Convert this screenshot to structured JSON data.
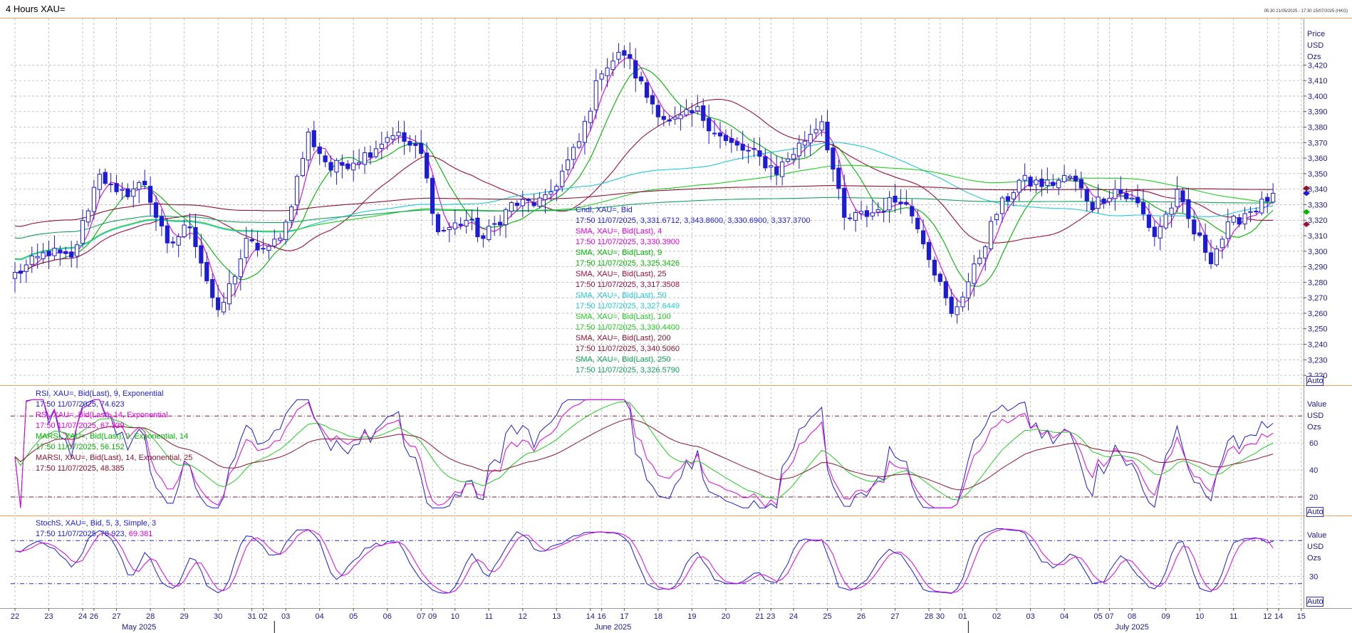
{
  "header": {
    "title": "4 Hours XAU=",
    "date_range": "05:30 21/05/2025 - 17:30 15/07/2025 (HKG)"
  },
  "colors": {
    "candle": "#1c1cd6",
    "sma4": "#e000e0",
    "sma9": "#00b400",
    "sma25": "#9c0f3c",
    "sma50": "#20c8d8",
    "sma100": "#22cc22",
    "sma200": "#8b1530",
    "sma250": "#13a05a",
    "rsi9": "#1c1cd6",
    "rsi14": "#e000e0",
    "marsi9": "#22cc22",
    "marsi14": "#8b1530",
    "stoch_k": "#1c1cd6",
    "stoch_d": "#e000e0",
    "grid": "#b4b4b4",
    "panel_border": "#f2a060"
  },
  "price_panel": {
    "axis_unit_lines": [
      "Price",
      "USD",
      "Ozs"
    ],
    "auto_label": "Auto",
    "legend": [
      {
        "text": "Cndl, XAU=, Bid",
        "color": "#1c1cd6"
      },
      {
        "text": "17:50 11/07/2025, 3,331.6712, 3,343.8600, 3,330.6900, 3,337.3700",
        "color": "#1c1cd6"
      },
      {
        "text": "SMA, XAU=, Bid(Last),  4",
        "color": "#e000e0"
      },
      {
        "text": "17:50 11/07/2025, 3,330.3900",
        "color": "#e000e0"
      },
      {
        "text": "SMA, XAU=, Bid(Last),  9",
        "color": "#00b400"
      },
      {
        "text": "17:50 11/07/2025, 3,325.3426",
        "color": "#00b400"
      },
      {
        "text": "SMA, XAU=, Bid(Last),  25",
        "color": "#9c0f3c"
      },
      {
        "text": "17:50 11/07/2025, 3,317.3508",
        "color": "#9c0f3c"
      },
      {
        "text": "SMA, XAU=, Bid(Last),  50",
        "color": "#20c8d8"
      },
      {
        "text": "17:50 11/07/2025, 3,327.6449",
        "color": "#20c8d8"
      },
      {
        "text": "SMA, XAU=, Bid(Last),  100",
        "color": "#22cc22"
      },
      {
        "text": "17:50 11/07/2025, 3,330.4400",
        "color": "#22cc22"
      },
      {
        "text": "SMA, XAU=, Bid(Last),  200",
        "color": "#8b1530"
      },
      {
        "text": "17:50 11/07/2025, 3,340.5060",
        "color": "#8b1530"
      },
      {
        "text": "SMA, XAU=, Bid(Last),  250",
        "color": "#13a05a"
      },
      {
        "text": "17:50 11/07/2025, 3,326.5790",
        "color": "#13a05a"
      }
    ]
  },
  "rsi_panel": {
    "axis_unit_lines": [
      "Value",
      "USD",
      "Ozs"
    ],
    "auto_label": "Auto",
    "legend": [
      {
        "text": "RSI, XAU=, Bid(Last),  9, Exponential",
        "color": "#1c1cd6"
      },
      {
        "text": "17:50 11/07/2025, 74.623",
        "color": "#1c1cd6"
      },
      {
        "text": "RSI, XAU=, Bid(Last),  14, Exponential",
        "color": "#e000e0"
      },
      {
        "text": "17:50 11/07/2025, 67.339",
        "color": "#e000e0"
      },
      {
        "text": "MARSI, XAU=, Bid(Last),  9, Exponential, 14",
        "color": "#00b400"
      },
      {
        "text": "17:50 11/07/2025, 56.152",
        "color": "#00b400"
      },
      {
        "text": "MARSI, XAU=, Bid(Last),  14, Exponential, 25",
        "color": "#8b1530"
      },
      {
        "text": "17:50 11/07/2025, 48.385",
        "color": "#8b1530"
      }
    ]
  },
  "stoch_panel": {
    "axis_unit_lines": [
      "Value",
      "USD",
      "Ozs"
    ],
    "auto_label": "Auto",
    "legend": [
      {
        "text": "StochS, XAU=, Bid,  5, 3, Simple, 3",
        "color": "#1c1cd6"
      }
    ],
    "legend_values": {
      "k": "17:50 11/07/2025, 78.923,",
      "d": " 69.381"
    }
  },
  "x_axis": {
    "day_ticks": [
      {
        "label": "22",
        "idx": 0
      },
      {
        "label": "23",
        "idx": 6
      },
      {
        "label": "24",
        "idx": 12
      },
      {
        "label": "26",
        "idx": 14
      },
      {
        "label": "27",
        "idx": 18
      },
      {
        "label": "28",
        "idx": 24
      },
      {
        "label": "29",
        "idx": 30
      },
      {
        "label": "30",
        "idx": 36
      },
      {
        "label": "31",
        "idx": 42
      },
      {
        "label": "02",
        "idx": 44
      },
      {
        "label": "03",
        "idx": 48
      },
      {
        "label": "04",
        "idx": 54
      },
      {
        "label": "05",
        "idx": 60
      },
      {
        "label": "06",
        "idx": 66
      },
      {
        "label": "07",
        "idx": 72
      },
      {
        "label": "09",
        "idx": 74
      },
      {
        "label": "10",
        "idx": 78
      },
      {
        "label": "11",
        "idx": 84
      },
      {
        "label": "12",
        "idx": 90
      },
      {
        "label": "13",
        "idx": 96
      },
      {
        "label": "14",
        "idx": 102
      },
      {
        "label": "16",
        "idx": 104
      },
      {
        "label": "17",
        "idx": 108
      },
      {
        "label": "18",
        "idx": 114
      },
      {
        "label": "19",
        "idx": 120
      },
      {
        "label": "20",
        "idx": 126
      },
      {
        "label": "21",
        "idx": 132
      },
      {
        "label": "23",
        "idx": 134
      },
      {
        "label": "24",
        "idx": 138
      },
      {
        "label": "25",
        "idx": 144
      },
      {
        "label": "26",
        "idx": 150
      },
      {
        "label": "27",
        "idx": 156
      },
      {
        "label": "28",
        "idx": 162
      },
      {
        "label": "30",
        "idx": 164
      },
      {
        "label": "01",
        "idx": 168
      },
      {
        "label": "02",
        "idx": 174
      },
      {
        "label": "03",
        "idx": 180
      },
      {
        "label": "04",
        "idx": 186
      },
      {
        "label": "05",
        "idx": 192
      },
      {
        "label": "07",
        "idx": 194
      },
      {
        "label": "08",
        "idx": 198
      },
      {
        "label": "09",
        "idx": 204
      },
      {
        "label": "10",
        "idx": 210
      },
      {
        "label": "11",
        "idx": 216
      },
      {
        "label": "12",
        "idx": 222
      },
      {
        "label": "14",
        "idx": 224
      },
      {
        "label": "15",
        "idx": 228
      }
    ],
    "months": [
      {
        "label": "May 2025",
        "idx": 22
      },
      {
        "label": "June 2025",
        "idx": 106
      },
      {
        "label": "July 2025",
        "idx": 198
      }
    ],
    "month_separators": [
      46,
      169
    ]
  },
  "chart_data": [
    {
      "type": "candlestick",
      "title": "4 Hours XAU=",
      "ylabel": "Price USD Ozs",
      "ylim": [
        3215,
        3450
      ],
      "yticks": [
        3220,
        3230,
        3240,
        3250,
        3260,
        3270,
        3280,
        3290,
        3300,
        3310,
        3320,
        3330,
        3340,
        3350,
        3360,
        3370,
        3380,
        3390,
        3400,
        3410,
        3420
      ],
      "x_count": 230,
      "waypoints": [
        [
          0,
          3285
        ],
        [
          6,
          3300
        ],
        [
          10,
          3294
        ],
        [
          15,
          3352
        ],
        [
          18,
          3335
        ],
        [
          23,
          3344
        ],
        [
          27,
          3302
        ],
        [
          31,
          3318
        ],
        [
          36,
          3258
        ],
        [
          41,
          3305
        ],
        [
          45,
          3300
        ],
        [
          48,
          3318
        ],
        [
          52,
          3375
        ],
        [
          56,
          3353
        ],
        [
          62,
          3362
        ],
        [
          67,
          3377
        ],
        [
          72,
          3362
        ],
        [
          75,
          3312
        ],
        [
          80,
          3320
        ],
        [
          83,
          3308
        ],
        [
          88,
          3330
        ],
        [
          94,
          3332
        ],
        [
          100,
          3370
        ],
        [
          104,
          3418
        ],
        [
          108,
          3428
        ],
        [
          112,
          3400
        ],
        [
          116,
          3382
        ],
        [
          121,
          3390
        ],
        [
          126,
          3370
        ],
        [
          131,
          3362
        ],
        [
          135,
          3352
        ],
        [
          139,
          3368
        ],
        [
          143,
          3385
        ],
        [
          147,
          3320
        ],
        [
          152,
          3325
        ],
        [
          157,
          3335
        ],
        [
          160,
          3318
        ],
        [
          164,
          3278
        ],
        [
          166,
          3258
        ],
        [
          170,
          3288
        ],
        [
          174,
          3325
        ],
        [
          178,
          3345
        ],
        [
          183,
          3343
        ],
        [
          187,
          3348
        ],
        [
          191,
          3330
        ],
        [
          195,
          3340
        ],
        [
          199,
          3330
        ],
        [
          202,
          3310
        ],
        [
          206,
          3336
        ],
        [
          209,
          3312
        ],
        [
          212,
          3296
        ],
        [
          215,
          3315
        ],
        [
          218,
          3325
        ],
        [
          221,
          3330
        ],
        [
          223,
          3338
        ]
      ],
      "series": [
        {
          "name": "Cndl, XAU=, Bid",
          "kind": "ohlc",
          "last": [
            3331.6712,
            3343.86,
            3330.69,
            3337.37
          ]
        },
        {
          "name": "SMA, XAU=, Bid(Last),  4",
          "period": 4,
          "last": 3330.39
        },
        {
          "name": "SMA, XAU=, Bid(Last),  9",
          "period": 9,
          "last": 3325.3426
        },
        {
          "name": "SMA, XAU=, Bid(Last),  25",
          "period": 25,
          "last": 3317.3508
        },
        {
          "name": "SMA, XAU=, Bid(Last),  50",
          "period": 50,
          "last": 3327.6449
        },
        {
          "name": "SMA, XAU=, Bid(Last),  100",
          "period": 100,
          "last": 3330.44
        },
        {
          "name": "SMA, XAU=, Bid(Last),  200",
          "period": 200,
          "last": 3340.506
        },
        {
          "name": "SMA, XAU=, Bid(Last),  250",
          "period": 250,
          "last": 3326.579
        }
      ]
    },
    {
      "type": "line",
      "ylim": [
        0,
        100
      ],
      "yticks": [
        20,
        40,
        60
      ],
      "reference_lines": [
        30,
        70
      ],
      "series": [
        {
          "name": "RSI, XAU=, Bid(Last),  9, Exponential",
          "last": 74.623
        },
        {
          "name": "RSI, XAU=, Bid(Last),  14, Exponential",
          "last": 67.339
        },
        {
          "name": "MARSI, XAU=, Bid(Last),  9, Exponential, 14",
          "last": 56.152
        },
        {
          "name": "MARSI, XAU=, Bid(Last),  14, Exponential, 25",
          "last": 48.385
        }
      ]
    },
    {
      "type": "line",
      "ylim": [
        0,
        100
      ],
      "yticks": [
        30
      ],
      "reference_lines": [
        20,
        80
      ],
      "series": [
        {
          "name": "StochS %K",
          "last": 78.923
        },
        {
          "name": "StochS %D",
          "last": 69.381
        }
      ]
    }
  ]
}
